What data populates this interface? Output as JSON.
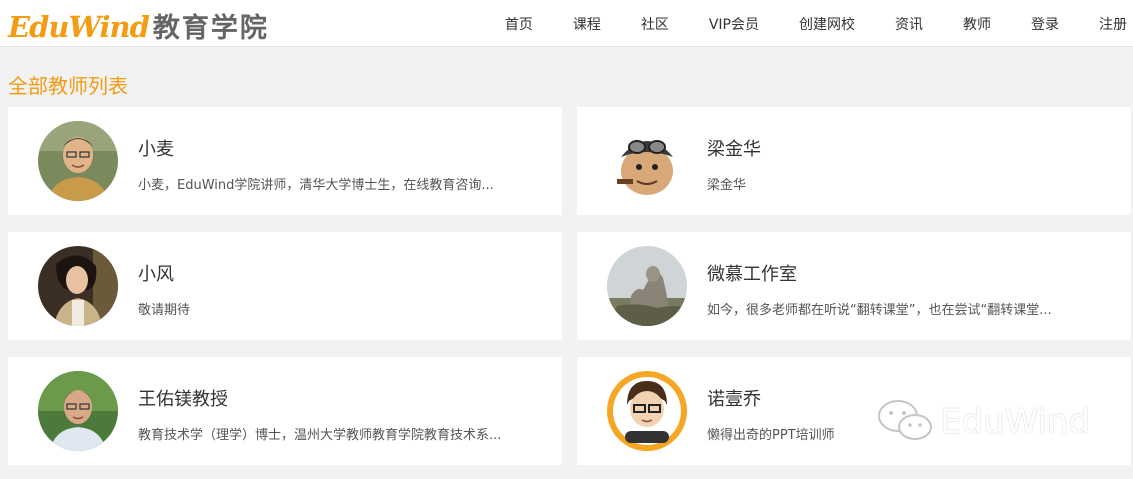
{
  "header": {
    "logo_en": "EduWind",
    "logo_cn": "教育学院",
    "nav": [
      "首页",
      "课程",
      "社区",
      "VIP会员",
      "创建网校",
      "资讯",
      "教师",
      "登录",
      "注册"
    ]
  },
  "page": {
    "title": "全部教师列表"
  },
  "teachers": [
    {
      "name": "小麦",
      "desc": "小麦，EduWind学院讲师，清华大学博士生，在线教育咨询..."
    },
    {
      "name": "梁金华",
      "desc": "梁金华"
    },
    {
      "name": "小风",
      "desc": "敬请期待"
    },
    {
      "name": "微慕工作室",
      "desc": "如今，很多老师都在听说“翻转课堂”，也在尝试“翻转课堂..."
    },
    {
      "name": "王佑镁教授",
      "desc": "教育技术学（理学）博士，温州大学教师教育学院教育技术系..."
    },
    {
      "name": "诺壹乔",
      "desc": "懒得出奇的PPT培训师"
    }
  ],
  "watermark": {
    "text": "EduWind"
  },
  "colors": {
    "accent": "#f39c12",
    "background": "#f2f2f2",
    "card": "#ffffff"
  }
}
